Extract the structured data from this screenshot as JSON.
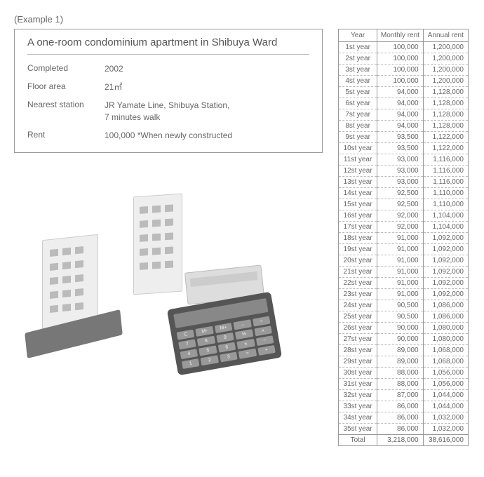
{
  "example_label": "(Example 1)",
  "info_title": "A one-room condominium apartment in Shibuya Ward",
  "fields": {
    "completed": {
      "label": "Completed",
      "value": "2002"
    },
    "floor_area": {
      "label": "Floor area",
      "value": "21㎡"
    },
    "nearest_station": {
      "label": "Nearest station",
      "value": "JR Yamate Line, Shibuya Station,\n7 minutes walk"
    },
    "rent": {
      "label": "Rent",
      "value": "100,000  *When newly constructed"
    }
  },
  "table": {
    "headers": {
      "year": "Year",
      "monthly": "Monthly rent",
      "annual": "Annual rent"
    },
    "rows": [
      {
        "year": "1st year",
        "monthly": "100,000",
        "annual": "1,200,000"
      },
      {
        "year": "2st year",
        "monthly": "100,000",
        "annual": "1,200,000"
      },
      {
        "year": "3st year",
        "monthly": "100,000",
        "annual": "1,200,000"
      },
      {
        "year": "4st year",
        "monthly": "100,000",
        "annual": "1,200,000"
      },
      {
        "year": "5st year",
        "monthly": "94,000",
        "annual": "1,128,000"
      },
      {
        "year": "6st year",
        "monthly": "94,000",
        "annual": "1,128,000"
      },
      {
        "year": "7st year",
        "monthly": "94,000",
        "annual": "1,128,000"
      },
      {
        "year": "8st year",
        "monthly": "94,000",
        "annual": "1,128,000"
      },
      {
        "year": "9st year",
        "monthly": "93,500",
        "annual": "1,122,000"
      },
      {
        "year": "10st year",
        "monthly": "93,500",
        "annual": "1,122,000"
      },
      {
        "year": "11st year",
        "monthly": "93,000",
        "annual": "1,116,000"
      },
      {
        "year": "12st year",
        "monthly": "93,000",
        "annual": "1,116,000"
      },
      {
        "year": "13st year",
        "monthly": "93,000",
        "annual": "1,116,000"
      },
      {
        "year": "14st year",
        "monthly": "92,500",
        "annual": "1,110,000"
      },
      {
        "year": "15st year",
        "monthly": "92,500",
        "annual": "1,110,000"
      },
      {
        "year": "16st year",
        "monthly": "92,000",
        "annual": "1,104,000"
      },
      {
        "year": "17st year",
        "monthly": "92,000",
        "annual": "1,104,000"
      },
      {
        "year": "18st year",
        "monthly": "91,000",
        "annual": "1,092,000"
      },
      {
        "year": "19st year",
        "monthly": "91,000",
        "annual": "1,092,000"
      },
      {
        "year": "20st year",
        "monthly": "91,000",
        "annual": "1,092,000"
      },
      {
        "year": "21st year",
        "monthly": "91,000",
        "annual": "1,092,000"
      },
      {
        "year": "22st year",
        "monthly": "91,000",
        "annual": "1,092,000"
      },
      {
        "year": "23st year",
        "monthly": "91,000",
        "annual": "1,092,000"
      },
      {
        "year": "24st year",
        "monthly": "90,500",
        "annual": "1,086,000"
      },
      {
        "year": "25st year",
        "monthly": "90,500",
        "annual": "1,086,000"
      },
      {
        "year": "26st year",
        "monthly": "90,000",
        "annual": "1,080,000"
      },
      {
        "year": "27st year",
        "monthly": "90,000",
        "annual": "1,080,000"
      },
      {
        "year": "28st year",
        "monthly": "89,000",
        "annual": "1,068,000"
      },
      {
        "year": "29st year",
        "monthly": "89,000",
        "annual": "1,068,000"
      },
      {
        "year": "30st year",
        "monthly": "88,000",
        "annual": "1,056,000"
      },
      {
        "year": "31st year",
        "monthly": "88,000",
        "annual": "1,056,000"
      },
      {
        "year": "32st year",
        "monthly": "87,000",
        "annual": "1,044,000"
      },
      {
        "year": "33st year",
        "monthly": "86,000",
        "annual": "1,044,000"
      },
      {
        "year": "34st year",
        "monthly": "86,000",
        "annual": "1,032,000"
      },
      {
        "year": "35st year",
        "monthly": "86,000",
        "annual": "1,032,000"
      }
    ],
    "total": {
      "label": "Total",
      "monthly": "3,218,000",
      "annual": "38,616,000"
    }
  },
  "chart_data": {
    "type": "table",
    "title": "Rent projection, Shibuya Ward one-room condominium",
    "columns": [
      "Year",
      "Monthly rent (JPY)",
      "Annual rent (JPY)"
    ],
    "rows": [
      [
        "1st year",
        100000,
        1200000
      ],
      [
        "2st year",
        100000,
        1200000
      ],
      [
        "3st year",
        100000,
        1200000
      ],
      [
        "4st year",
        100000,
        1200000
      ],
      [
        "5st year",
        94000,
        1128000
      ],
      [
        "6st year",
        94000,
        1128000
      ],
      [
        "7st year",
        94000,
        1128000
      ],
      [
        "8st year",
        94000,
        1128000
      ],
      [
        "9st year",
        93500,
        1122000
      ],
      [
        "10st year",
        93500,
        1122000
      ],
      [
        "11st year",
        93000,
        1116000
      ],
      [
        "12st year",
        93000,
        1116000
      ],
      [
        "13st year",
        93000,
        1116000
      ],
      [
        "14st year",
        92500,
        1110000
      ],
      [
        "15st year",
        92500,
        1110000
      ],
      [
        "16st year",
        92000,
        1104000
      ],
      [
        "17st year",
        92000,
        1104000
      ],
      [
        "18st year",
        91000,
        1092000
      ],
      [
        "19st year",
        91000,
        1092000
      ],
      [
        "20st year",
        91000,
        1092000
      ],
      [
        "21st year",
        91000,
        1092000
      ],
      [
        "22st year",
        91000,
        1092000
      ],
      [
        "23st year",
        91000,
        1092000
      ],
      [
        "24st year",
        90500,
        1086000
      ],
      [
        "25st year",
        90500,
        1086000
      ],
      [
        "26st year",
        90000,
        1080000
      ],
      [
        "27st year",
        90000,
        1080000
      ],
      [
        "28st year",
        89000,
        1068000
      ],
      [
        "29st year",
        89000,
        1068000
      ],
      [
        "30st year",
        88000,
        1056000
      ],
      [
        "31st year",
        88000,
        1056000
      ],
      [
        "32st year",
        87000,
        1044000
      ],
      [
        "33st year",
        86000,
        1044000
      ],
      [
        "34st year",
        86000,
        1032000
      ],
      [
        "35st year",
        86000,
        1032000
      ]
    ],
    "totals": {
      "monthly_sum": 3218000,
      "annual_sum": 38616000
    }
  }
}
